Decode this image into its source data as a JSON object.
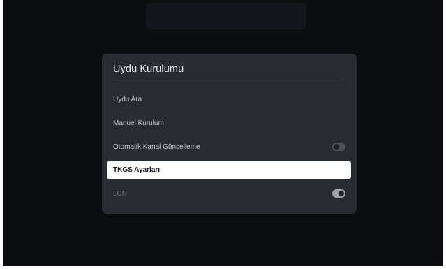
{
  "dialog": {
    "title": "Uydu Kurulumu",
    "items": [
      {
        "label": "Uydu Ara"
      },
      {
        "label": "Manuel Kurulum"
      },
      {
        "label": "Otomatik Kanal Güncelleme",
        "toggle": "off"
      },
      {
        "label": "TKGS Ayarları",
        "focused": true
      },
      {
        "label": "LCN",
        "toggle": "on",
        "disabled": true
      }
    ]
  }
}
